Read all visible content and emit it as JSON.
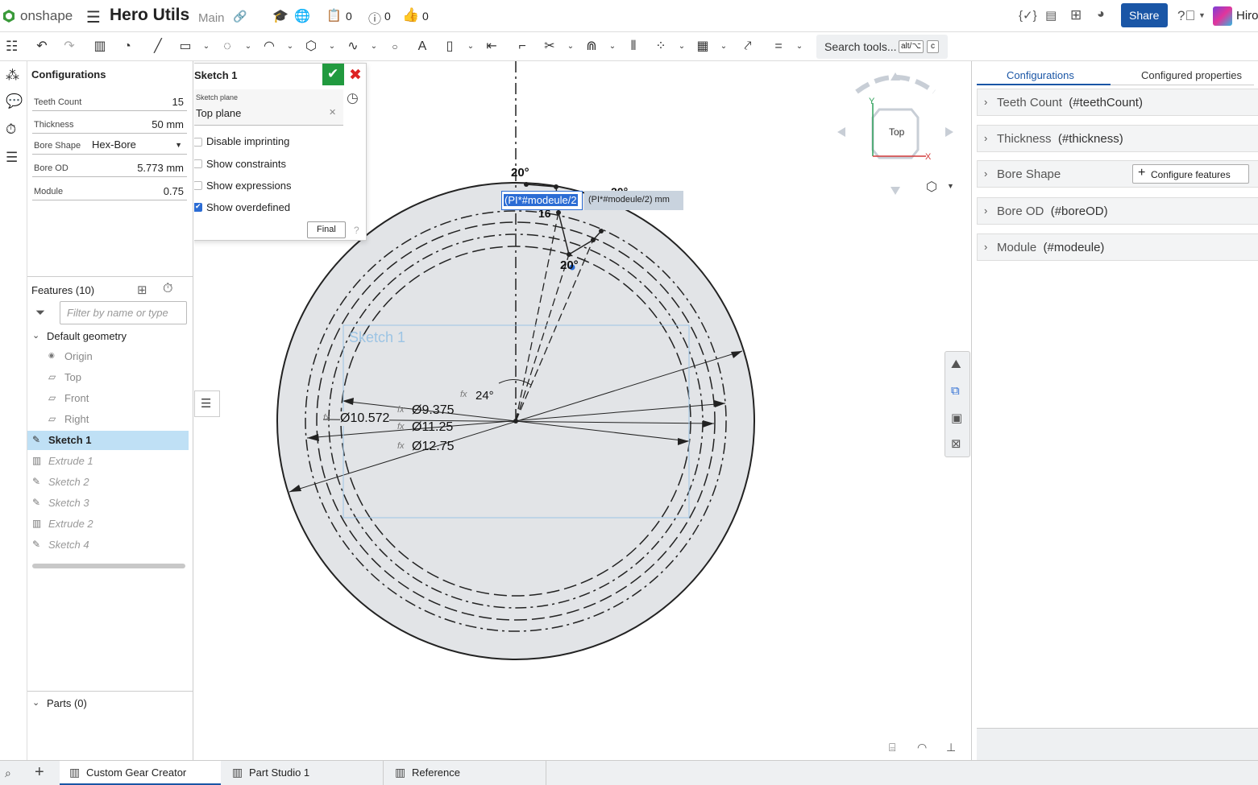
{
  "topbar": {
    "logo": "onshape",
    "doc_title": "Hero Utils",
    "branch": "Main",
    "count_docs": "0",
    "count_comments": "0",
    "count_likes": "0",
    "share_label": "Share",
    "user_name": "Hiro",
    "accent": "#1a56a6"
  },
  "toolbar": {
    "search_placeholder": "Search tools...",
    "shortcut_a": "alt/⌥",
    "shortcut_b": "c"
  },
  "configurations": {
    "title": "Configurations",
    "rows": [
      {
        "label": "Teeth Count",
        "value": "15"
      },
      {
        "label": "Thickness",
        "value": "50 mm"
      },
      {
        "label": "Bore Shape",
        "value": "Hex-Bore"
      },
      {
        "label": "Bore OD",
        "value": "5.773 mm"
      },
      {
        "label": "Module",
        "value": "0.75"
      }
    ]
  },
  "features": {
    "title": "Features (10)",
    "filter_placeholder": "Filter by name or type",
    "group": "Default geometry",
    "items": [
      "Origin",
      "Top",
      "Front",
      "Right",
      "Sketch 1",
      "Extrude 1",
      "Sketch 2",
      "Sketch 3",
      "Extrude 2",
      "Sketch 4"
    ]
  },
  "parts": {
    "title": "Parts (0)"
  },
  "sketch_dialog": {
    "title": "Sketch 1",
    "plane_label": "Sketch plane",
    "plane_value": "Top plane",
    "options": [
      {
        "label": "Disable imprinting",
        "checked": false
      },
      {
        "label": "Show constraints",
        "checked": false
      },
      {
        "label": "Show expressions",
        "checked": false
      },
      {
        "label": "Show overdefined",
        "checked": true
      }
    ],
    "final_label": "Final"
  },
  "viewport": {
    "sketch_label": "Sketch 1",
    "view_cube_label": "Top",
    "axis_y": "Y",
    "axis_x": "X",
    "edit_value": "(PI*#modeule/2",
    "edit_preview": "(PI*#modeule/2) mm",
    "dims": {
      "d1": "Ø9.375",
      "d2": "Ø11.25",
      "d3": "Ø12.75",
      "d4": "Ø10.572",
      "angle": "24°",
      "a_top": "20°",
      "a_mid": "20°",
      "a_right": "20°",
      "small": "16"
    },
    "fx": "fx"
  },
  "right_panel": {
    "tab_active": "Configurations",
    "tab_other": "Configured properties",
    "rows": [
      {
        "name": "Teeth Count",
        "id": "(#teethCount)"
      },
      {
        "name": "Thickness",
        "id": "(#thickness)"
      },
      {
        "name": "Bore Shape",
        "id": ""
      },
      {
        "name": "Bore OD",
        "id": "(#boreOD)"
      },
      {
        "name": "Module",
        "id": "(#modeule)"
      }
    ],
    "configure_features": "Configure features"
  },
  "bottom_tabs": [
    "Custom Gear Creator",
    "Part Studio 1",
    "Reference"
  ]
}
